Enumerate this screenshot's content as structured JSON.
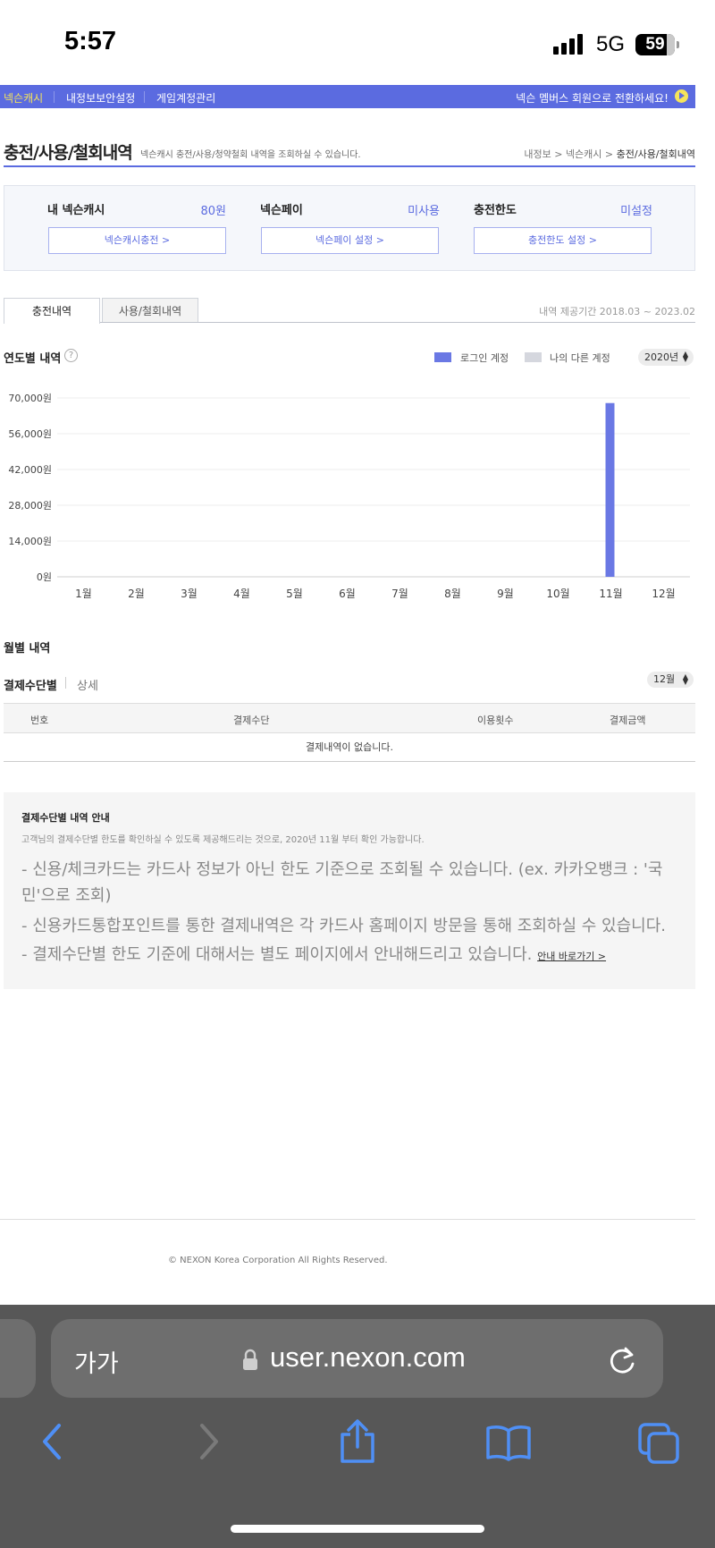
{
  "status_bar": {
    "time": "5:57",
    "network": "5G",
    "battery": "59"
  },
  "top_nav": {
    "items": [
      "넥슨캐시",
      "내정보보안설정",
      "게임계정관리"
    ],
    "promo": "넥슨 멤버스 회원으로 전환하세요!"
  },
  "page": {
    "title": "충전/사용/철회내역",
    "description": "넥슨캐시 충전/사용/청약철회 내역을 조회하실 수 있습니다.",
    "breadcrumb": [
      "내정보",
      "넥슨캐시",
      "충전/사용/철회내역"
    ]
  },
  "summary": {
    "cash": {
      "label": "내 넥슨캐시",
      "value": "80원",
      "button": "넥슨캐시충전 >"
    },
    "pay": {
      "label": "넥슨페이",
      "value": "미사용",
      "button": "넥슨페이 설정 >"
    },
    "limit": {
      "label": "충전한도",
      "value": "미설정",
      "button": "충전한도 설정 >"
    }
  },
  "tabs": [
    "충전내역",
    "사용/철회내역"
  ],
  "period": "내역 제공기간 2018.03 ~ 2023.02",
  "annual": {
    "title": "연도별 내역",
    "legend": [
      "로그인 계정",
      "나의 다른 계정"
    ],
    "year": "2020년"
  },
  "chart_data": {
    "type": "bar",
    "categories": [
      "1월",
      "2월",
      "3월",
      "4월",
      "5월",
      "6월",
      "7월",
      "8월",
      "9월",
      "10월",
      "11월",
      "12월"
    ],
    "series": [
      {
        "name": "로그인 계정",
        "color": "#6a78e4",
        "values": [
          0,
          0,
          0,
          0,
          0,
          0,
          0,
          0,
          0,
          0,
          68000,
          0
        ]
      },
      {
        "name": "나의 다른 계정",
        "color": "#d5d7de",
        "values": [
          0,
          0,
          0,
          0,
          0,
          0,
          0,
          0,
          0,
          0,
          0,
          0
        ]
      }
    ],
    "yticks": [
      "0원",
      "14,000원",
      "28,000원",
      "42,000원",
      "56,000원",
      "70,000원"
    ],
    "ylim": [
      0,
      70000
    ],
    "grid": true
  },
  "monthly": {
    "title": "월별 내역",
    "tab_active": "결제수단별",
    "tab_other": "상세",
    "month": "12월",
    "columns": [
      "번호",
      "결제수단",
      "이용횟수",
      "결제금액"
    ],
    "empty": "결제내역이 없습니다."
  },
  "info": {
    "title": "결제수단별 내역 안내",
    "subtitle": "고객님의 결제수단별 한도를 확인하실 수 있도록 제공해드리는 것으로, 2020년 11월 부터 확인 가능합니다.",
    "line1": "- 신용/체크카드는 카드사 정보가 아닌 한도 기준으로 조회될 수 있습니다. (ex. 카카오뱅크 : '국민'으로 조회)",
    "line2": "- 신용카드통합포인트를 통한 결제내역은 각 카드사 홈페이지 방문을 통해 조회하실 수 있습니다.",
    "line3": "- 결제수단별 한도 기준에 대해서는 별도 페이지에서 안내해드리고 있습니다.",
    "link": "안내 바로가기 >"
  },
  "footer": {
    "copyright": "© NEXON Korea Corporation All Rights Reserved."
  },
  "browser": {
    "text_size": "가가",
    "url": "user.nexon.com"
  }
}
